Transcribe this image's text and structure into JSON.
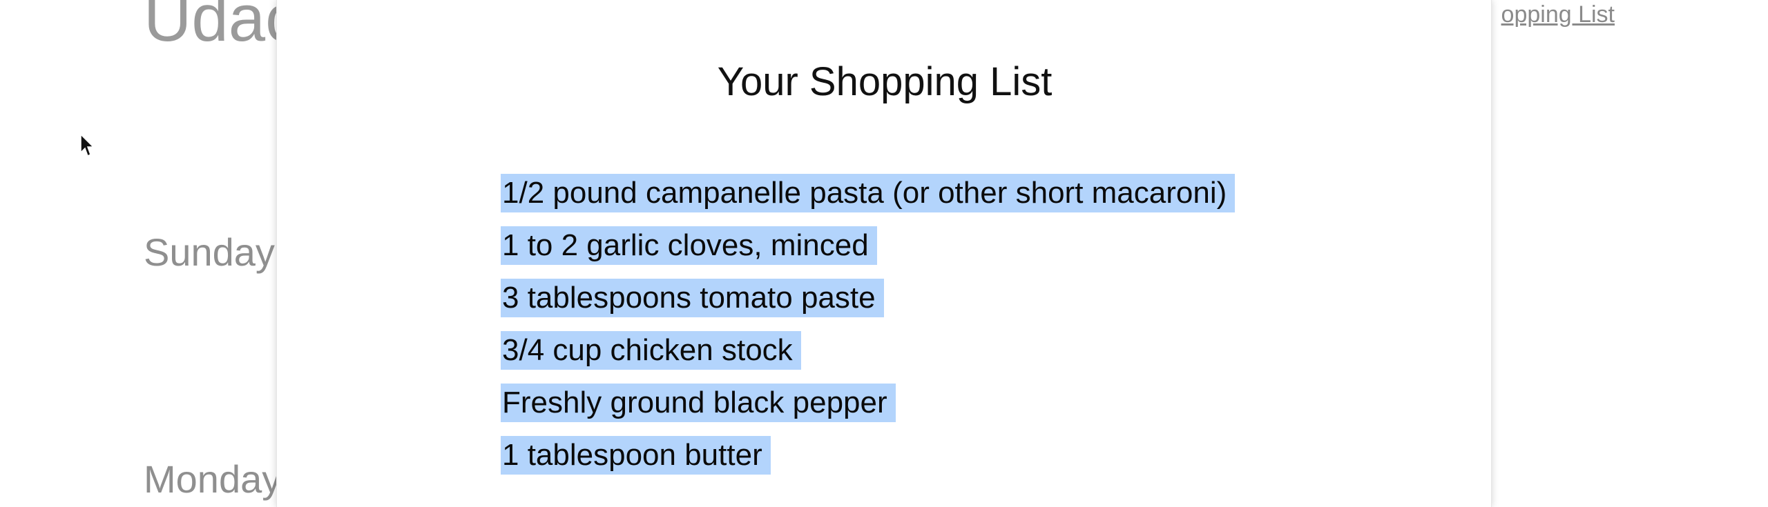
{
  "background": {
    "app_title": "Udac",
    "top_link": "opping List",
    "days": [
      "Sunday",
      "Monday"
    ]
  },
  "modal": {
    "title": "Your Shopping List",
    "items": [
      "1/2 pound campanelle pasta (or other short macaroni)",
      "1 to 2 garlic cloves, minced",
      "3 tablespoons tomato paste",
      "3/4 cup chicken stock",
      "Freshly ground black pepper",
      "1 tablespoon butter"
    ]
  },
  "colors": {
    "selection": "#b3d4fc",
    "background_text": "#9a9a9a"
  },
  "icons": {
    "cursor": "arrow-cursor-icon"
  }
}
